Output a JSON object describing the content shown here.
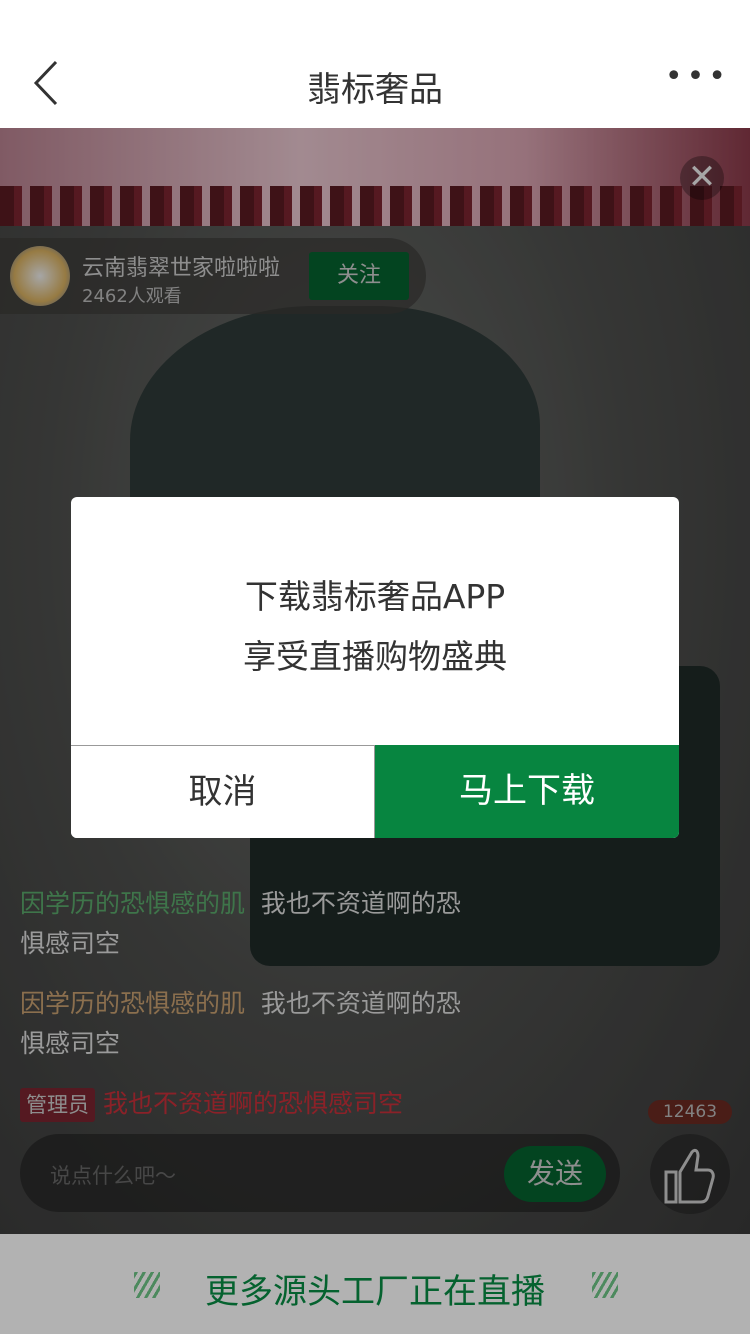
{
  "nav": {
    "title": "翡标奢品",
    "more": "•••"
  },
  "banner": {
    "close": "✕"
  },
  "host": {
    "name": "云南翡翠世家啦啦啦",
    "viewers": "2462人观看",
    "follow": "关注"
  },
  "chat": [
    {
      "user": "因学历的恐惧感的肌",
      "user_color": "#5aa86a",
      "text": "我也不资道啊的恐惧感司空"
    },
    {
      "user": "因学历的恐惧感的肌",
      "user_color": "#a88a5a",
      "text": "我也不资道啊的恐惧感司空"
    },
    {
      "badge": "管理员",
      "text": "我也不资道啊的恐惧感司空",
      "text_color": "#a0252f"
    }
  ],
  "input": {
    "placeholder": "说点什么吧～",
    "send": "发送"
  },
  "like": {
    "count": "12463"
  },
  "bottom": {
    "text": "更多源头工厂正在直播"
  },
  "modal": {
    "line1": "下载翡标奢品APP",
    "line2": "享受直播购物盛典",
    "cancel": "取消",
    "download": "马上下载"
  },
  "colors": {
    "brand": "#078540"
  }
}
